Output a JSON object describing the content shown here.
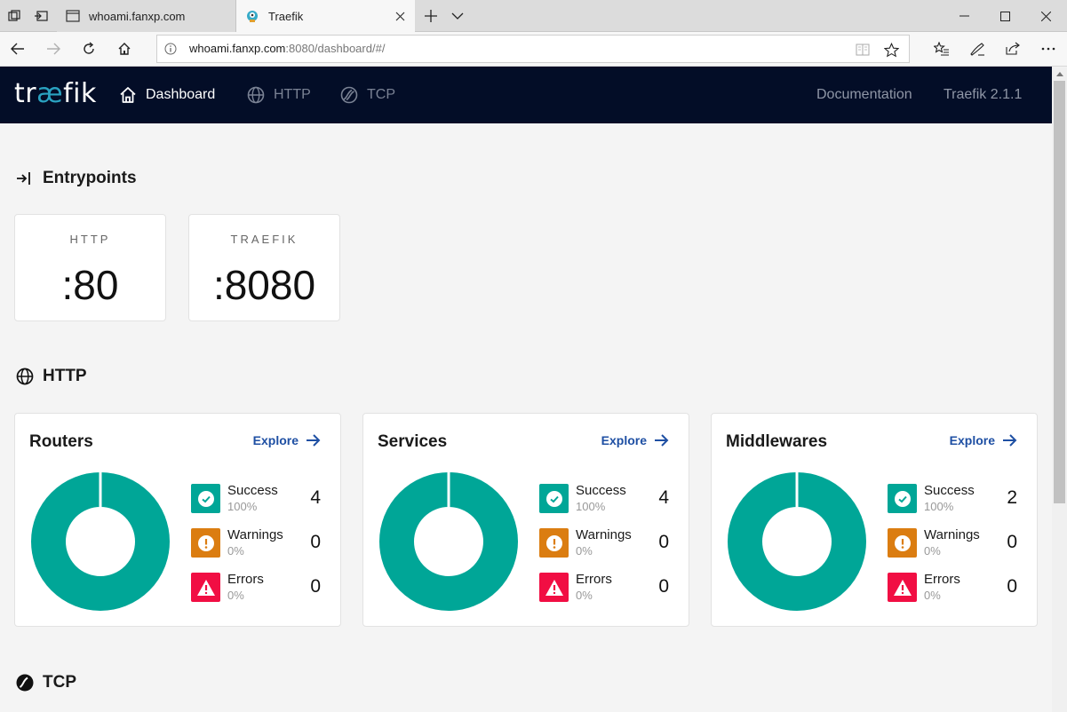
{
  "browser": {
    "tabs": [
      {
        "title": "whoami.fanxp.com",
        "active": false
      },
      {
        "title": "Traefik",
        "active": true
      }
    ],
    "url_host": "whoami.fanxp.com",
    "url_rest": ":8080/dashboard/#/"
  },
  "app": {
    "logo_pre": "tr",
    "logo_ae": "æ",
    "logo_post": "fik",
    "nav": [
      {
        "label": "Dashboard",
        "icon": "home-icon",
        "active": true
      },
      {
        "label": "HTTP",
        "icon": "globe-icon",
        "active": false
      },
      {
        "label": "TCP",
        "icon": "tcp-icon",
        "active": false
      }
    ],
    "nav_right": [
      {
        "label": "Documentation"
      },
      {
        "label": "Traefik 2.1.1"
      }
    ]
  },
  "entrypoints": {
    "title": "Entrypoints",
    "items": [
      {
        "name": "HTTP",
        "port": ":80"
      },
      {
        "name": "TRAEFIK",
        "port": ":8080"
      }
    ]
  },
  "http": {
    "title": "HTTP",
    "cards": [
      {
        "title": "Routers",
        "explore": "Explore",
        "stats": [
          {
            "label": "Success",
            "pct": "100%",
            "count": "4",
            "kind": "success"
          },
          {
            "label": "Warnings",
            "pct": "0%",
            "count": "0",
            "kind": "warning"
          },
          {
            "label": "Errors",
            "pct": "0%",
            "count": "0",
            "kind": "error"
          }
        ]
      },
      {
        "title": "Services",
        "explore": "Explore",
        "stats": [
          {
            "label": "Success",
            "pct": "100%",
            "count": "4",
            "kind": "success"
          },
          {
            "label": "Warnings",
            "pct": "0%",
            "count": "0",
            "kind": "warning"
          },
          {
            "label": "Errors",
            "pct": "0%",
            "count": "0",
            "kind": "error"
          }
        ]
      },
      {
        "title": "Middlewares",
        "explore": "Explore",
        "stats": [
          {
            "label": "Success",
            "pct": "100%",
            "count": "2",
            "kind": "success"
          },
          {
            "label": "Warnings",
            "pct": "0%",
            "count": "0",
            "kind": "warning"
          },
          {
            "label": "Errors",
            "pct": "0%",
            "count": "0",
            "kind": "error"
          }
        ]
      }
    ]
  },
  "tcp": {
    "title": "TCP"
  },
  "colors": {
    "navbar": "#030d27",
    "success": "#00a697",
    "warning": "#db7d11",
    "error": "#f10e43",
    "link": "#1e4fa3"
  }
}
